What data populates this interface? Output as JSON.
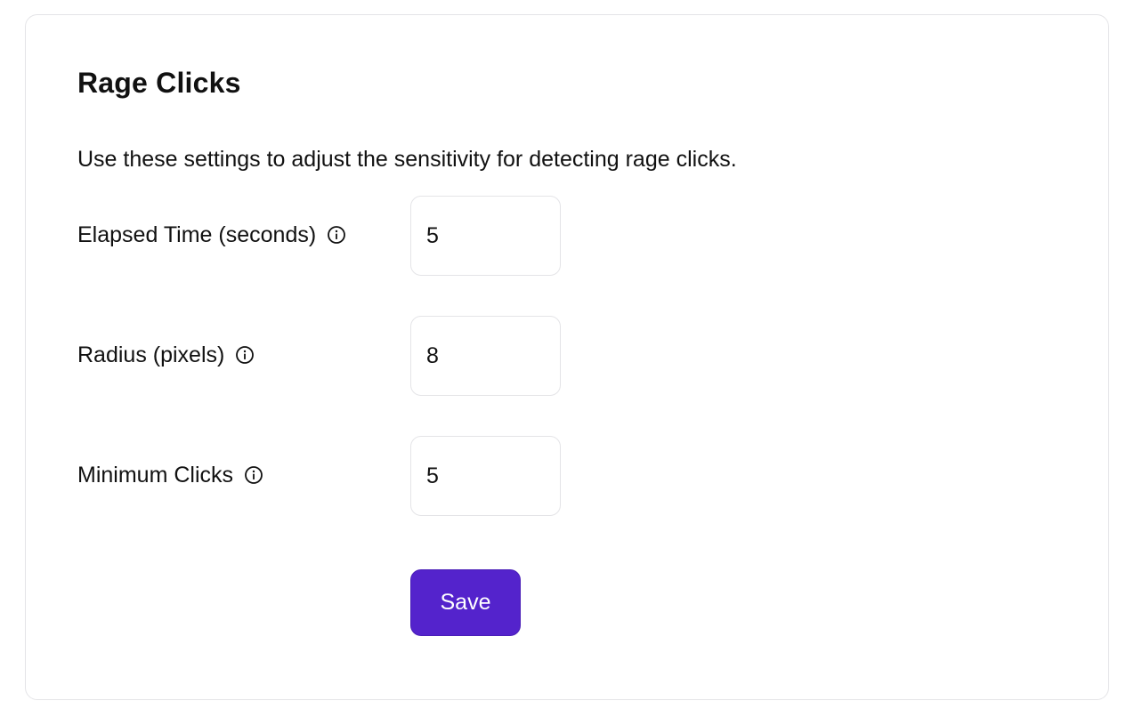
{
  "section": {
    "title": "Rage Clicks",
    "description": "Use these settings to adjust the sensitivity for detecting rage clicks."
  },
  "fields": {
    "elapsed_time": {
      "label": "Elapsed Time (seconds)",
      "value": "5"
    },
    "radius": {
      "label": "Radius (pixels)",
      "value": "8"
    },
    "minimum_clicks": {
      "label": "Minimum Clicks",
      "value": "5"
    }
  },
  "actions": {
    "save_label": "Save"
  },
  "colors": {
    "primary": "#5423cc",
    "border": "#e4e4e7",
    "text": "#111111"
  }
}
